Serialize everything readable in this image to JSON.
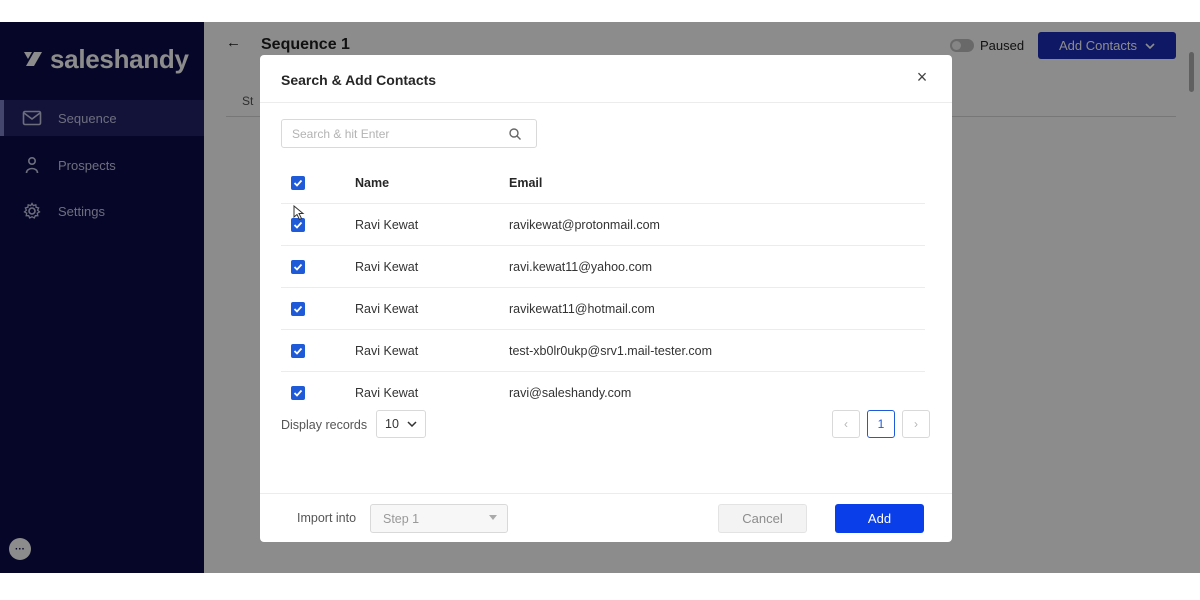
{
  "app": {
    "logo_text": "saleshandy"
  },
  "sidebar": {
    "items": [
      {
        "label": "Sequence",
        "icon": "mail-icon",
        "active": true
      },
      {
        "label": "Prospects",
        "icon": "person-icon",
        "active": false
      },
      {
        "label": "Settings",
        "icon": "gear-icon",
        "active": false
      }
    ],
    "chat_label": "···"
  },
  "header": {
    "back_glyph": "←",
    "title": "Sequence 1",
    "paused_label": "Paused",
    "add_contacts_label": "Add Contacts",
    "tab_fragment": "St"
  },
  "modal": {
    "title": "Search & Add Contacts",
    "close_glyph": "×",
    "search": {
      "placeholder": "Search & hit Enter",
      "value": ""
    },
    "columns": {
      "name": "Name",
      "email": "Email"
    },
    "rows": [
      {
        "name": "Ravi Kewat",
        "email": "ravikewat@protonmail.com",
        "checked": true
      },
      {
        "name": "Ravi Kewat",
        "email": "ravi.kewat11@yahoo.com",
        "checked": true
      },
      {
        "name": "Ravi Kewat",
        "email": "ravikewat11@hotmail.com",
        "checked": true
      },
      {
        "name": "Ravi Kewat",
        "email": "test-xb0lr0ukp@srv1.mail-tester.com",
        "checked": true
      },
      {
        "name": "Ravi Kewat",
        "email": "ravi@saleshandy.com",
        "checked": true
      }
    ],
    "display_records_label": "Display records",
    "display_records_value": "10",
    "pagination": {
      "prev": "‹",
      "current": "1",
      "next": "›"
    },
    "import_into_label": "Import into",
    "import_into_value": "Step 1",
    "cancel_label": "Cancel",
    "add_label": "Add"
  },
  "colors": {
    "sidebar_bg": "#0b0b4a",
    "primary": "#0a3ee8",
    "checkbox": "#1f5bd8"
  }
}
